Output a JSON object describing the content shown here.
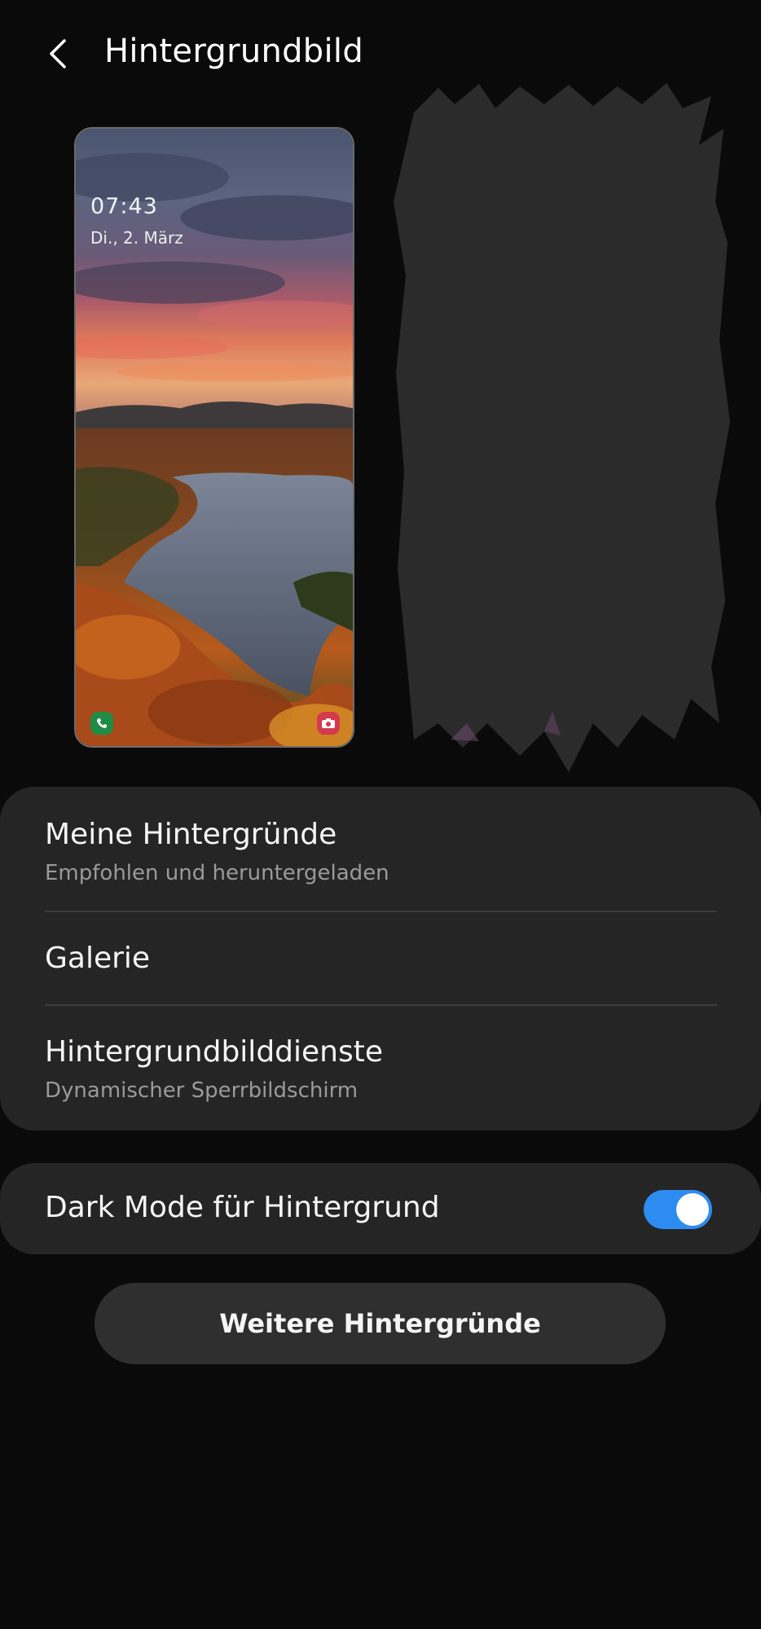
{
  "header": {
    "title": "Hintergrundbild",
    "back_icon": "chevron-left-icon"
  },
  "lock_preview": {
    "time": "07:43",
    "date": "Di., 2. März",
    "left_shortcut_icon": "phone-icon",
    "right_shortcut_icon": "camera-icon"
  },
  "options": [
    {
      "title": "Meine Hintergründe",
      "subtitle": "Empfohlen und heruntergeladen"
    },
    {
      "title": "Galerie"
    },
    {
      "title": "Hintergrundbilddienste",
      "subtitle": "Dynamischer Sperrbildschirm"
    }
  ],
  "dark_mode": {
    "label": "Dark Mode für Hintergrund",
    "enabled": true
  },
  "more_button": {
    "label": "Weitere Hintergründe"
  },
  "colors": {
    "background": "#0a0a0a",
    "card": "#252525",
    "toggle_on": "#2d8cf0",
    "phone_icon": "#1f8c46",
    "camera_icon": "#d43a4c"
  }
}
